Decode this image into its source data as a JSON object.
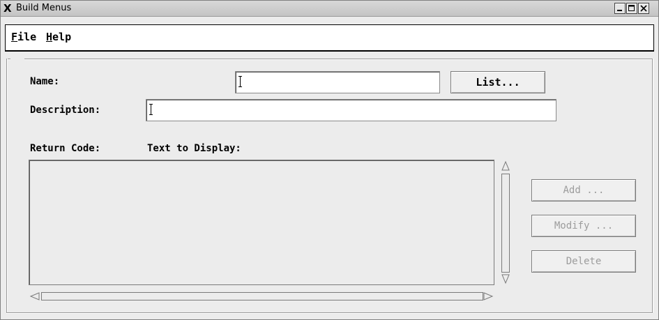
{
  "window": {
    "title": "Build Menus",
    "logo_glyph": "X"
  },
  "menubar": {
    "file": {
      "accel": "F",
      "rest": "ile"
    },
    "help": {
      "accel": "H",
      "rest": "elp"
    }
  },
  "form": {
    "name_label": "Name:",
    "name_value": "",
    "list_button": "List...",
    "description_label": "Description:",
    "description_value": "",
    "return_code_header": "Return Code:",
    "text_display_header": "Text to Display:",
    "items": []
  },
  "actions": {
    "add": "Add ...",
    "modify": "Modify ...",
    "delete": "Delete"
  },
  "icons": {
    "window_minimize": "minimize-icon",
    "window_maximize": "maximize-icon",
    "window_close": "close-icon",
    "scroll_up": "up-arrow-icon",
    "scroll_down": "down-arrow-icon",
    "scroll_left": "left-arrow-icon",
    "scroll_right": "right-arrow-icon"
  }
}
